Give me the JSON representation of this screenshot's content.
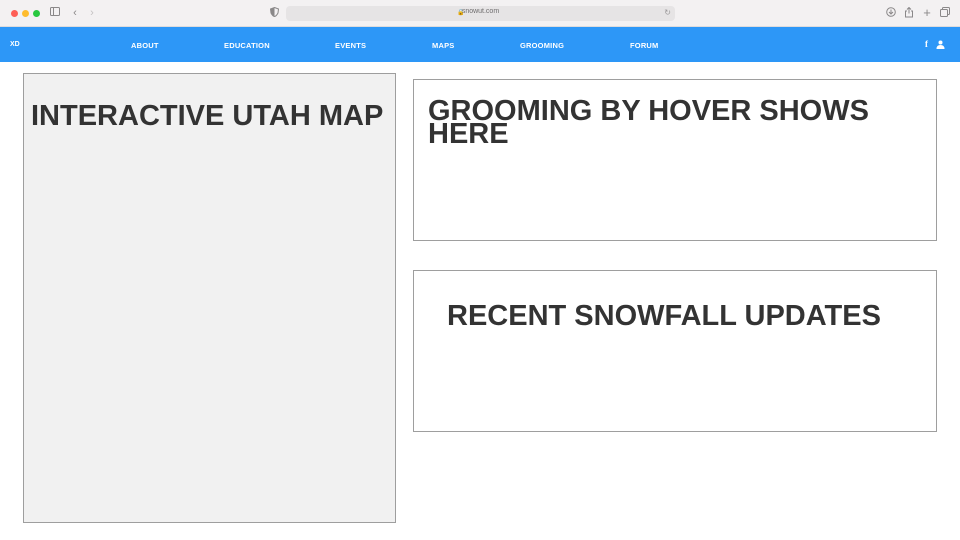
{
  "browser": {
    "url": "snowut.com"
  },
  "nav": {
    "logo": "XD",
    "items": [
      "ABOUT",
      "EDUCATION",
      "EVENTS",
      "MAPS",
      "GROOMING",
      "FORUM"
    ],
    "background": "#2d97f7"
  },
  "icons": {
    "facebook": "facebook-icon",
    "user": "user-icon"
  },
  "panels": {
    "map_title": "INTERACTIVE UTAH MAP",
    "grooming_title": "GROOMING BY HOVER SHOWS HERE",
    "snowfall_title": "RECENT SNOWFALL UPDATES"
  }
}
